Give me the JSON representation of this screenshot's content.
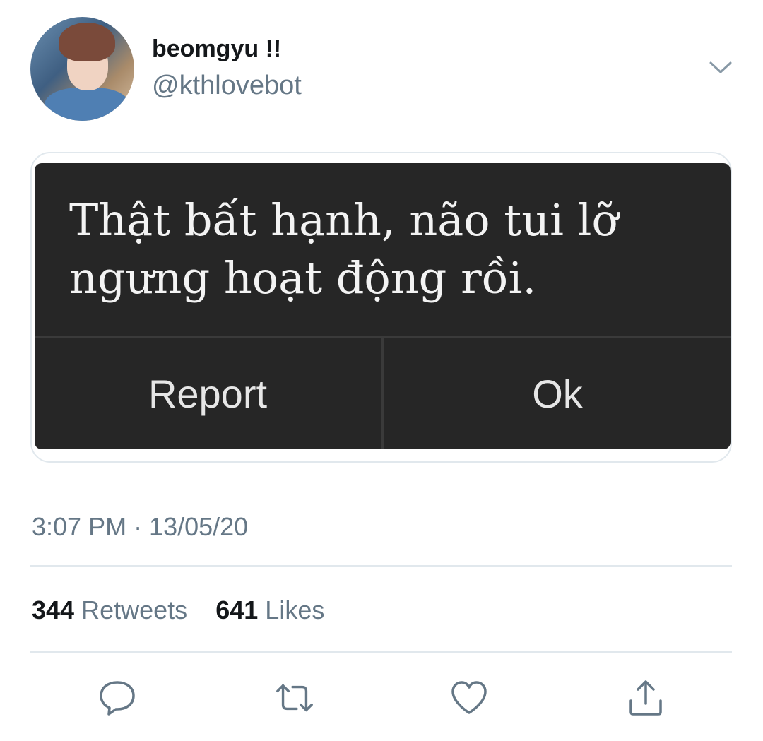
{
  "user": {
    "display_name": "beomgyu !!",
    "handle": "@kthlovebot"
  },
  "media": {
    "message": "Thật bất hạnh, não tui lỡ ngưng hoạt động rồi.",
    "buttons": {
      "report_label": "Report",
      "ok_label": "Ok"
    }
  },
  "timestamp": "3:07 PM · 13/05/20",
  "stats": {
    "retweets_count": "344",
    "retweets_label": "Retweets",
    "likes_count": "641",
    "likes_label": "Likes"
  },
  "actions": {
    "icons": [
      "reply-icon",
      "retweet-icon",
      "like-icon",
      "share-icon"
    ]
  },
  "colors": {
    "text_primary": "#14171a",
    "text_secondary": "#657786",
    "divider": "#e1e8ed",
    "dialog_bg": "#262626"
  }
}
